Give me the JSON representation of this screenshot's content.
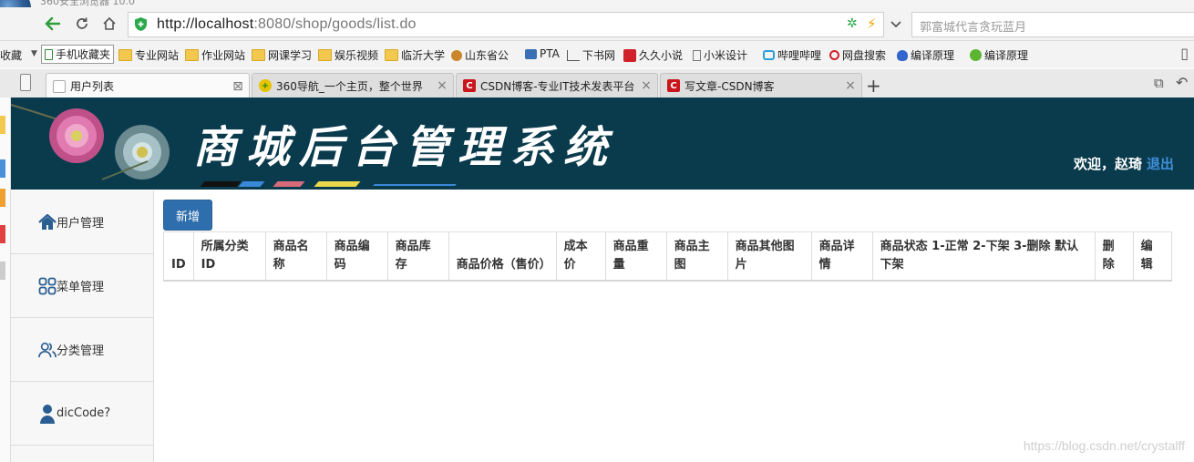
{
  "browser": {
    "url_host": "http://localhost",
    "url_rest": ":8080/shop/goods/list.do",
    "search_placeholder": "郭富城代言贪玩蓝月"
  },
  "bookmarks": [
    {
      "label": "收藏",
      "icon": "none"
    },
    {
      "label": "手机收藏夹",
      "icon": "phone-icon"
    },
    {
      "label": "专业网站",
      "icon": "folder-icon"
    },
    {
      "label": "作业网站",
      "icon": "folder-icon"
    },
    {
      "label": "网课学习",
      "icon": "folder-icon"
    },
    {
      "label": "娱乐视频",
      "icon": "folder-icon"
    },
    {
      "label": "临沂大学",
      "icon": "folder-icon"
    },
    {
      "label": "山东省公",
      "icon": "seal-icon"
    },
    {
      "label": "PTA",
      "icon": "pta-icon"
    },
    {
      "label": "下书网",
      "icon": "book-icon"
    },
    {
      "label": "久久小说",
      "icon": "99-icon"
    },
    {
      "label": "小米设计",
      "icon": "doc-icon"
    },
    {
      "label": "哔哩哔哩",
      "icon": "bilibili-icon"
    },
    {
      "label": "网盘搜索",
      "icon": "search-icon"
    },
    {
      "label": "编译原理",
      "icon": "baidu-paw-icon"
    },
    {
      "label": "编译原理",
      "icon": "green-circle-icon"
    }
  ],
  "tabs": [
    {
      "title": "用户列表",
      "active": true,
      "favicon": "doc-icon"
    },
    {
      "title": "360导航_一个主页，整个世界",
      "active": false,
      "favicon": "360-icon"
    },
    {
      "title": "CSDN博客-专业IT技术发表平台",
      "active": false,
      "favicon": "csdn-icon"
    },
    {
      "title": "写文章-CSDN博客",
      "active": false,
      "favicon": "csdn-icon"
    }
  ],
  "header": {
    "title": "商城后台管理系统",
    "welcome": "欢迎，赵琦",
    "logout": "退出"
  },
  "sidebar": {
    "items": [
      {
        "label": "用户管理",
        "icon": "home-icon"
      },
      {
        "label": "菜单管理",
        "icon": "grid-icon"
      },
      {
        "label": "分类管理",
        "icon": "users-icon"
      },
      {
        "label": "dicCode?",
        "icon": "user-icon"
      }
    ]
  },
  "toolbar": {
    "add_label": "新增"
  },
  "table": {
    "columns": [
      "ID",
      "所属分类ID",
      "商品名称",
      "商品编码",
      "商品库存",
      "商品价格（售价）",
      "成本价",
      "商品重量",
      "商品主图",
      "商品其他图片",
      "商品详情",
      "商品状态 1-正常 2-下架 3-删除 默认下架",
      "删除",
      "编辑"
    ],
    "rows": []
  },
  "watermark": "https://blog.csdn.net/crystalff",
  "colors": {
    "banner_bg": "#0a3b4d",
    "primary_button": "#2f6ead",
    "logout_link": "#3f8ed8"
  }
}
